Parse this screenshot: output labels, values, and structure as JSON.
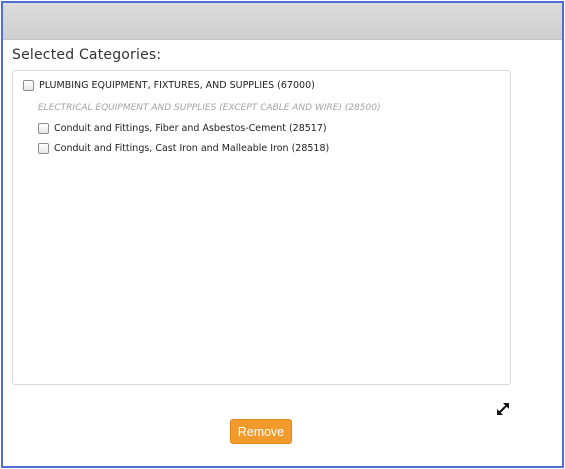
{
  "section": {
    "title": "Selected Categories:"
  },
  "categories": {
    "item_plumbing": "PLUMBING EQUIPMENT, FIXTURES, AND SUPPLIES (67000)",
    "group_electrical": "ELECTRICAL EQUIPMENT AND SUPPLIES (EXCEPT CABLE AND WIRE) (28500)",
    "item_fiber": "Conduit and Fittings, Fiber and Asbestos-Cement (28517)",
    "item_cast_iron": "Conduit and Fittings, Cast Iron and Malleable Iron (28518)"
  },
  "checkbox_states": {
    "item_plumbing": false,
    "item_fiber": false,
    "item_cast_iron": false
  },
  "icons": {
    "expand": "expand-arrows-icon"
  },
  "actions": {
    "remove_label": "Remove"
  },
  "colors": {
    "frame_border": "#4f6fd6",
    "remove_button": "#f39a2c"
  }
}
